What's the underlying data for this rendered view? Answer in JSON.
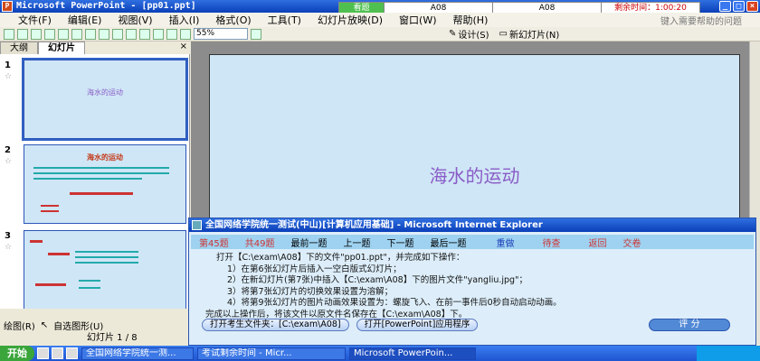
{
  "window": {
    "title": "Microsoft PowerPoint - [pp01.ppt]",
    "app_icon": "P"
  },
  "timer": {
    "status": "看题",
    "code1": "A08",
    "code2": "A08",
    "remaining": "剩余时间：1:00:20"
  },
  "menu": {
    "items": [
      "文件(F)",
      "编辑(E)",
      "视图(V)",
      "插入(I)",
      "格式(O)",
      "工具(T)",
      "幻灯片放映(D)",
      "窗口(W)",
      "帮助(H)"
    ],
    "help_placeholder": "键入需要帮助的问题"
  },
  "toolbar": {
    "zoom": "55%",
    "design_label": "设计(S)",
    "new_slide_label": "新幻灯片(N)"
  },
  "tabs": {
    "outline": "大纲",
    "slides": "幻灯片",
    "close": "×"
  },
  "thumbnails": [
    {
      "number": "1",
      "title": "海水的运动"
    },
    {
      "number": "2",
      "title": "海水的运动"
    },
    {
      "number": "3",
      "title": ""
    }
  ],
  "draw_toolbar": {
    "draw": "绘图(R)",
    "autoshapes": "自选图形(U)"
  },
  "status": {
    "slide_indicator": "幻灯片 1 / 8"
  },
  "slide": {
    "title": "海水的运动"
  },
  "dialog": {
    "title": "全国网络学院统一测试(中山)[计算机应用基础] - Microsoft Internet Explorer",
    "nav": {
      "current": "第45题",
      "total": "共49题",
      "first": "最前一题",
      "prev": "上一题",
      "next": "下一题",
      "last": "最后一题",
      "redo": "重做",
      "review": "待查",
      "back": "返回",
      "submit": "交卷"
    },
    "instructions": [
      "打开【C:\\exam\\A08】下的文件\"pp01.ppt\"，并完成如下操作：",
      "1）在第6张幻灯片后插入一空白版式幻灯片；",
      "2）在新幻灯片(第7张)中插入【C:\\exam\\A08】下的图片文件\"yangliu.jpg\"；",
      "3）将第7张幻灯片的切换效果设置为溶解；",
      "4）将第9张幻灯片的图片动画效果设置为：螺旋飞入、在前一事件后0秒自动启动动画。",
      "完成以上操作后，将该文件以原文件名保存在【C:\\exam\\A08】下。"
    ],
    "btn_open_folder": "打开考生文件夹：[C:\\exam\\A08]",
    "btn_open_app": "打开[PowerPoint]应用程序",
    "btn_score": "评  分"
  },
  "taskbar": {
    "start": "开始",
    "tasks": [
      "全国网络学院统一测...",
      "考试剩余时间 - Micr...",
      "Microsoft PowerPoin..."
    ]
  }
}
